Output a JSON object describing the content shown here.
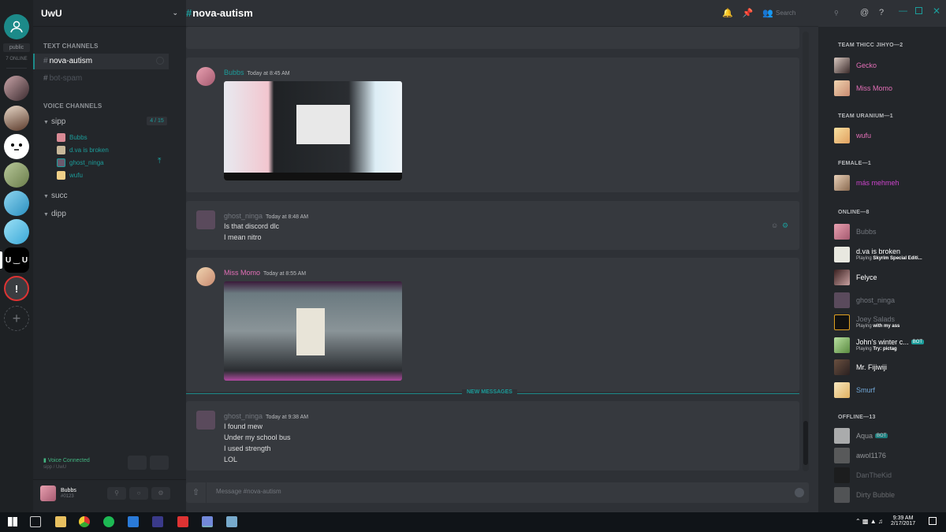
{
  "colors": {
    "accent": "#1c9c9a",
    "pink": "#e36fb7",
    "magenta": "#cc44cc",
    "muted": "#72767d"
  },
  "rail": {
    "public_label": "public",
    "online_label": "7 ONLINE",
    "uwu_label": "U ‿ U",
    "alert_label": "!"
  },
  "guild": {
    "name": "UwU"
  },
  "channels": {
    "text_header": "TEXT CHANNELS",
    "text": [
      {
        "name": "nova-autism"
      },
      {
        "name": "bot-spam"
      }
    ],
    "voice_header": "VOICE CHANNELS",
    "voice": [
      {
        "name": "sipp",
        "count": "4 / 15"
      },
      {
        "name": "succ"
      },
      {
        "name": "dipp"
      }
    ],
    "voice_users": [
      "Bubbs",
      "d.va is broken",
      "ghost_ninga",
      "wufu"
    ],
    "voice_connected": "Voice Connected",
    "voice_sub": "sipp / UwU"
  },
  "user": {
    "name": "Bubbs",
    "disc": "#0123"
  },
  "chat": {
    "channel": "nova-autism",
    "search_placeholder": "Search",
    "messages": [
      {
        "author": "Bubbs",
        "time": "Today at 8:45 AM",
        "lines": []
      },
      {
        "author": "ghost_ninga",
        "time": "Today at 8:48 AM",
        "lines": [
          "Is that discord dlc",
          "I mean nitro"
        ]
      },
      {
        "author": "Miss Momo",
        "time": "Today at 8:55 AM",
        "lines": []
      },
      {
        "author": "ghost_ninga",
        "time": "Today at 9:38 AM",
        "lines": [
          "I found mew",
          "Under my school bus",
          "I used strength",
          "LOL"
        ]
      }
    ],
    "new_messages": "NEW MESSAGES",
    "composer_placeholder": "Message #nova-autism"
  },
  "members": {
    "groups": [
      {
        "title": "TEAM THICC JIHYO—2",
        "members": [
          {
            "name": "Gecko"
          },
          {
            "name": "Miss Momo"
          }
        ]
      },
      {
        "title": "TEAM URANIUM—1",
        "members": [
          {
            "name": "wufu"
          }
        ]
      },
      {
        "title": "FEMALE—1",
        "members": [
          {
            "name": "más mehmeh"
          }
        ]
      },
      {
        "title": "ONLINE—8",
        "members": [
          {
            "name": "Bubbs"
          },
          {
            "name": "d.va is broken",
            "playing": "Playing ",
            "game": "Skyrim Special Editi..."
          },
          {
            "name": "Felyce"
          },
          {
            "name": "ghost_ninga"
          },
          {
            "name": "Joey Salads",
            "playing": "Playing ",
            "game": "with my ass"
          },
          {
            "name": "John's winter c...",
            "bot": "BOT",
            "playing": "Playing ",
            "game": "Try: pictag"
          },
          {
            "name": "Mr. Fijiwiji"
          },
          {
            "name": "Smurf"
          }
        ]
      },
      {
        "title": "OFFLINE—13",
        "members": [
          {
            "name": "Aqua",
            "bot": "BOT"
          },
          {
            "name": "awol1176"
          },
          {
            "name": "DanTheKid"
          },
          {
            "name": "Dirty Bubble"
          }
        ]
      }
    ]
  },
  "taskbar": {
    "time": "9:39 AM",
    "date": "2/17/2017"
  }
}
